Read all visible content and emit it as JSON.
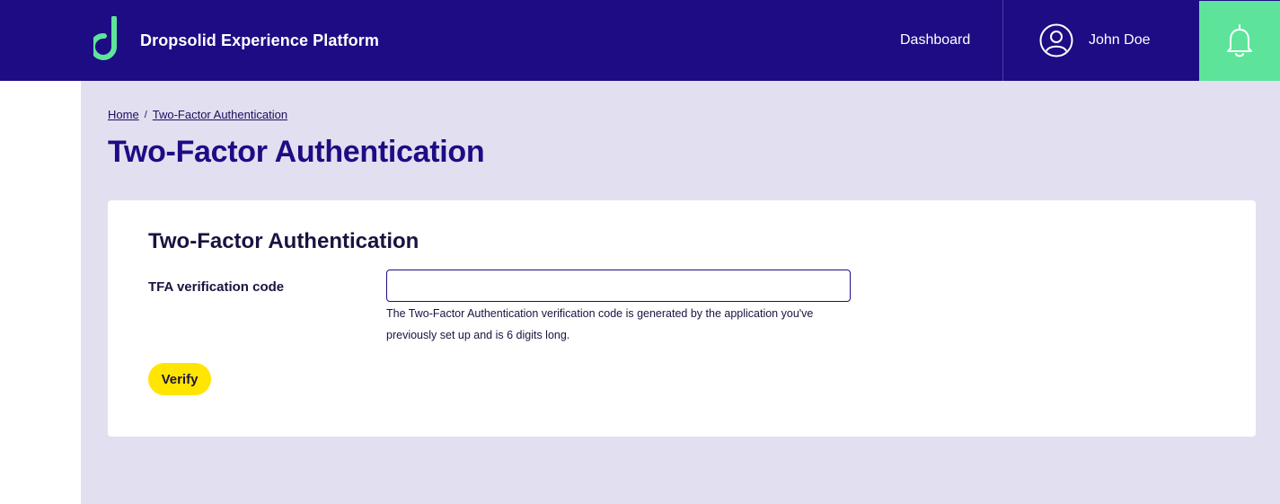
{
  "header": {
    "brand_name": "Dropsolid Experience Platform",
    "logo_icon": "dropsolid-d-logo",
    "nav_dashboard": "Dashboard",
    "user_name": "John Doe",
    "user_icon": "user-circle-icon",
    "notification_icon": "bell-icon",
    "colors": {
      "background": "#1e0c84",
      "accent": "#5ee49a"
    }
  },
  "breadcrumb": {
    "home": "Home",
    "separator": "/",
    "current": "Two-Factor Authentication"
  },
  "page_title": "Two-Factor Authentication",
  "form": {
    "title": "Two-Factor Authentication",
    "code_label": "TFA verification code",
    "code_value": "",
    "help_line1": "The Two-Factor Authentication verification code is generated by the application you've",
    "help_line2": "previously set up and is 6 digits long.",
    "verify_label": "Verify",
    "colors": {
      "button": "#ffe500",
      "page_background": "#e2dff0"
    }
  }
}
